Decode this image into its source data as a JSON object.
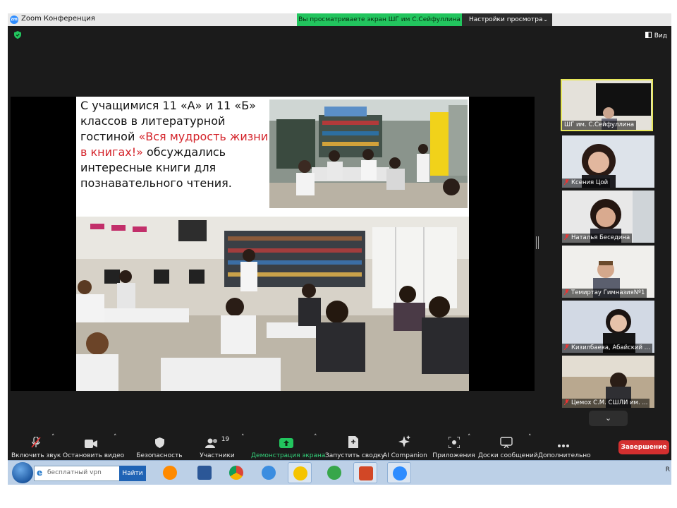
{
  "window": {
    "app_title": "Zoom Конференция",
    "share_banner": "Вы просматриваете экран ШГ им С.Сейфуллина",
    "view_options": "Настройки просмотра",
    "view_button": "Вид"
  },
  "slide": {
    "text_before": "С учащимися 11 «А» и 11 «Б» классов в литературной гостиной ",
    "text_red": "«Вся мудрость жизни в книгах!»",
    "text_after": " обсуждались интересные книги для познавательного чтения.",
    "red_color": "#d4232a"
  },
  "participants": [
    {
      "name": "ШГ им. С.Сейфуллина",
      "active": true,
      "muted": false
    },
    {
      "name": "Ксения Цой",
      "active": false,
      "muted": true
    },
    {
      "name": "Наталья Беседина",
      "active": false,
      "muted": true
    },
    {
      "name": "Темиртау ГимназияNº1",
      "active": false,
      "muted": true
    },
    {
      "name": "Кизилбаева, Абайский ...",
      "active": false,
      "muted": true
    },
    {
      "name": "Цемох С.М. СШЛИ им. ...",
      "active": false,
      "muted": true
    }
  ],
  "toolbar": {
    "unmute": "Включить звук",
    "stop_video": "Остановить видео",
    "security": "Безопасность",
    "participants": "Участники",
    "participants_count": "19",
    "share_screen": "Демонстрация экрана",
    "summary": "Запустить сводку",
    "ai_companion": "AI Companion",
    "apps": "Приложения",
    "whiteboards": "Доски сообщений",
    "more": "Дополнительно",
    "end": "Завершение"
  },
  "taskbar": {
    "search_placeholder": "бесплатный vpn",
    "search_button": "Найти",
    "tray_text": "R"
  },
  "colors": {
    "accent_green": "#22c55e",
    "end_red": "#d42f2f",
    "active_tile_border": "#e7e75a"
  }
}
